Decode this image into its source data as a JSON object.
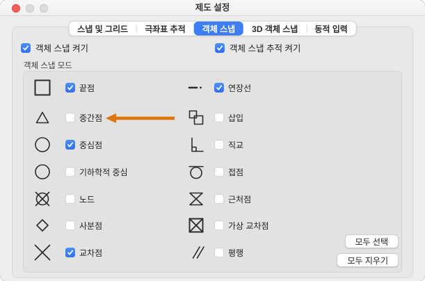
{
  "window": {
    "title": "제도 설정"
  },
  "tabs": [
    {
      "key": "snap-grid",
      "label": "스냅 및 그리드",
      "selected": false
    },
    {
      "key": "polar-tracking",
      "label": "극좌표 추적",
      "selected": false
    },
    {
      "key": "object-snap",
      "label": "객체 스냅",
      "selected": true
    },
    {
      "key": "3d-object-snap",
      "label": "3D 객체 스냅",
      "selected": false
    },
    {
      "key": "dynamic-input",
      "label": "동적 입력",
      "selected": false
    }
  ],
  "header_toggles": [
    {
      "key": "object-snap-on",
      "label": "객체 스냅 켜기",
      "checked": true
    },
    {
      "key": "object-snap-tracking-on",
      "label": "객체 스냅 추적 켜기",
      "checked": true
    }
  ],
  "group": {
    "title": "객체 스냅 모드",
    "left_items": [
      {
        "key": "endpoint",
        "icon": "endpoint-icon",
        "label": "끝점",
        "checked": true
      },
      {
        "key": "midpoint",
        "icon": "midpoint-icon",
        "label": "중간점",
        "checked": false
      },
      {
        "key": "center",
        "icon": "center-icon",
        "label": "중심점",
        "checked": true
      },
      {
        "key": "geometric-center",
        "icon": "geometric-center-icon",
        "label": "기하학적 중심",
        "checked": false
      },
      {
        "key": "node",
        "icon": "node-icon",
        "label": "노드",
        "checked": false
      },
      {
        "key": "quadrant",
        "icon": "quadrant-icon",
        "label": "사분점",
        "checked": false
      },
      {
        "key": "intersection",
        "icon": "intersection-icon",
        "label": "교차점",
        "checked": true
      }
    ],
    "right_items": [
      {
        "key": "extension",
        "icon": "extension-icon",
        "label": "연장선",
        "checked": true
      },
      {
        "key": "insertion",
        "icon": "insertion-icon",
        "label": "삽입",
        "checked": false
      },
      {
        "key": "perpendicular",
        "icon": "perpendicular-icon",
        "label": "직교",
        "checked": false
      },
      {
        "key": "tangent",
        "icon": "tangent-icon",
        "label": "접점",
        "checked": false
      },
      {
        "key": "nearest",
        "icon": "nearest-icon",
        "label": "근처점",
        "checked": false
      },
      {
        "key": "apparent-intersection",
        "icon": "apparent-intersection-icon",
        "label": "가상 교차점",
        "checked": false
      },
      {
        "key": "parallel",
        "icon": "parallel-icon",
        "label": "평행",
        "checked": false
      }
    ],
    "buttons": [
      {
        "key": "select-all",
        "label": "모두 선택"
      },
      {
        "key": "clear-all",
        "label": "모두 지우기"
      }
    ]
  },
  "annotation": {
    "arrow_color": "#e0750c",
    "points_to": "중간점"
  },
  "colors": {
    "accent": "#3d7ef5",
    "checkbox_checked": "#3b82f7",
    "icon_stroke": "#2b2b2b"
  }
}
